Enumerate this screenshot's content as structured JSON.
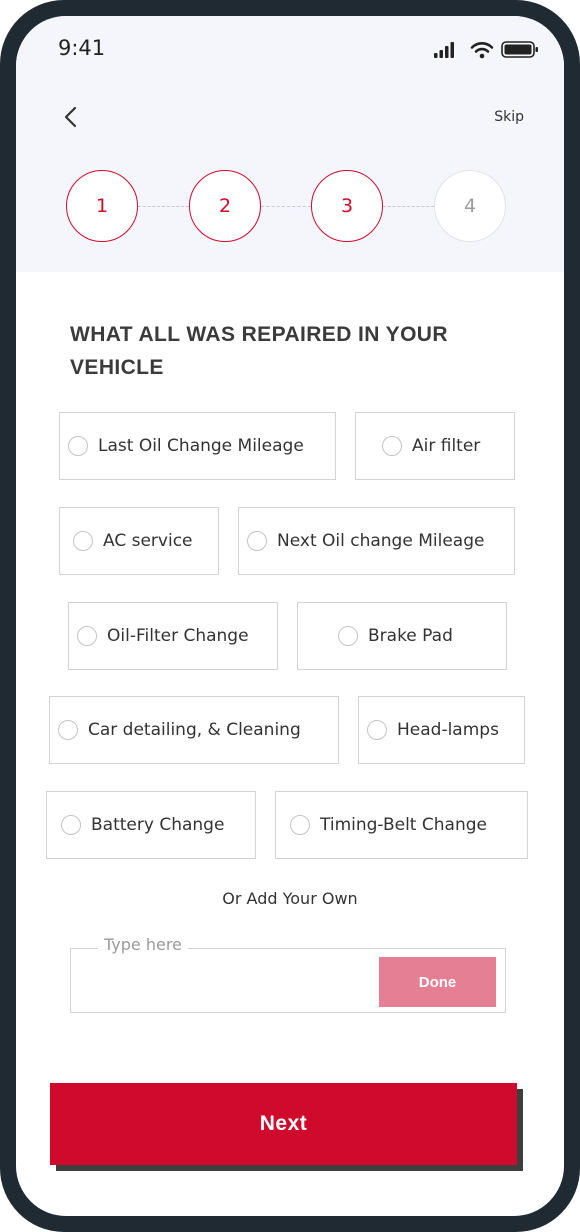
{
  "status": {
    "time": "9:41"
  },
  "header": {
    "skip_label": "Skip",
    "back_icon": "chevron-left-icon"
  },
  "stepper": {
    "steps": [
      "1",
      "2",
      "3",
      "4"
    ],
    "current_step": 3
  },
  "page": {
    "title": "WHAT ALL WAS REPAIRED IN YOUR VEHICLE"
  },
  "options": [
    "Last Oil Change Mileage",
    "Air filter",
    "AC service",
    "Next Oil change Mileage",
    "Oil-Filter Change",
    "Brake Pad",
    "Car detailing, & Cleaning",
    "Head-lamps",
    "Battery Change",
    "Timing-Belt Change"
  ],
  "custom": {
    "or_label": "Or Add Your Own",
    "placeholder": "Type here",
    "done_label": "Done"
  },
  "footer": {
    "next_label": "Next"
  },
  "colors": {
    "accent": "#cf0a2c",
    "done_bg": "#e57f93",
    "header_bg": "#f5f6fb"
  }
}
